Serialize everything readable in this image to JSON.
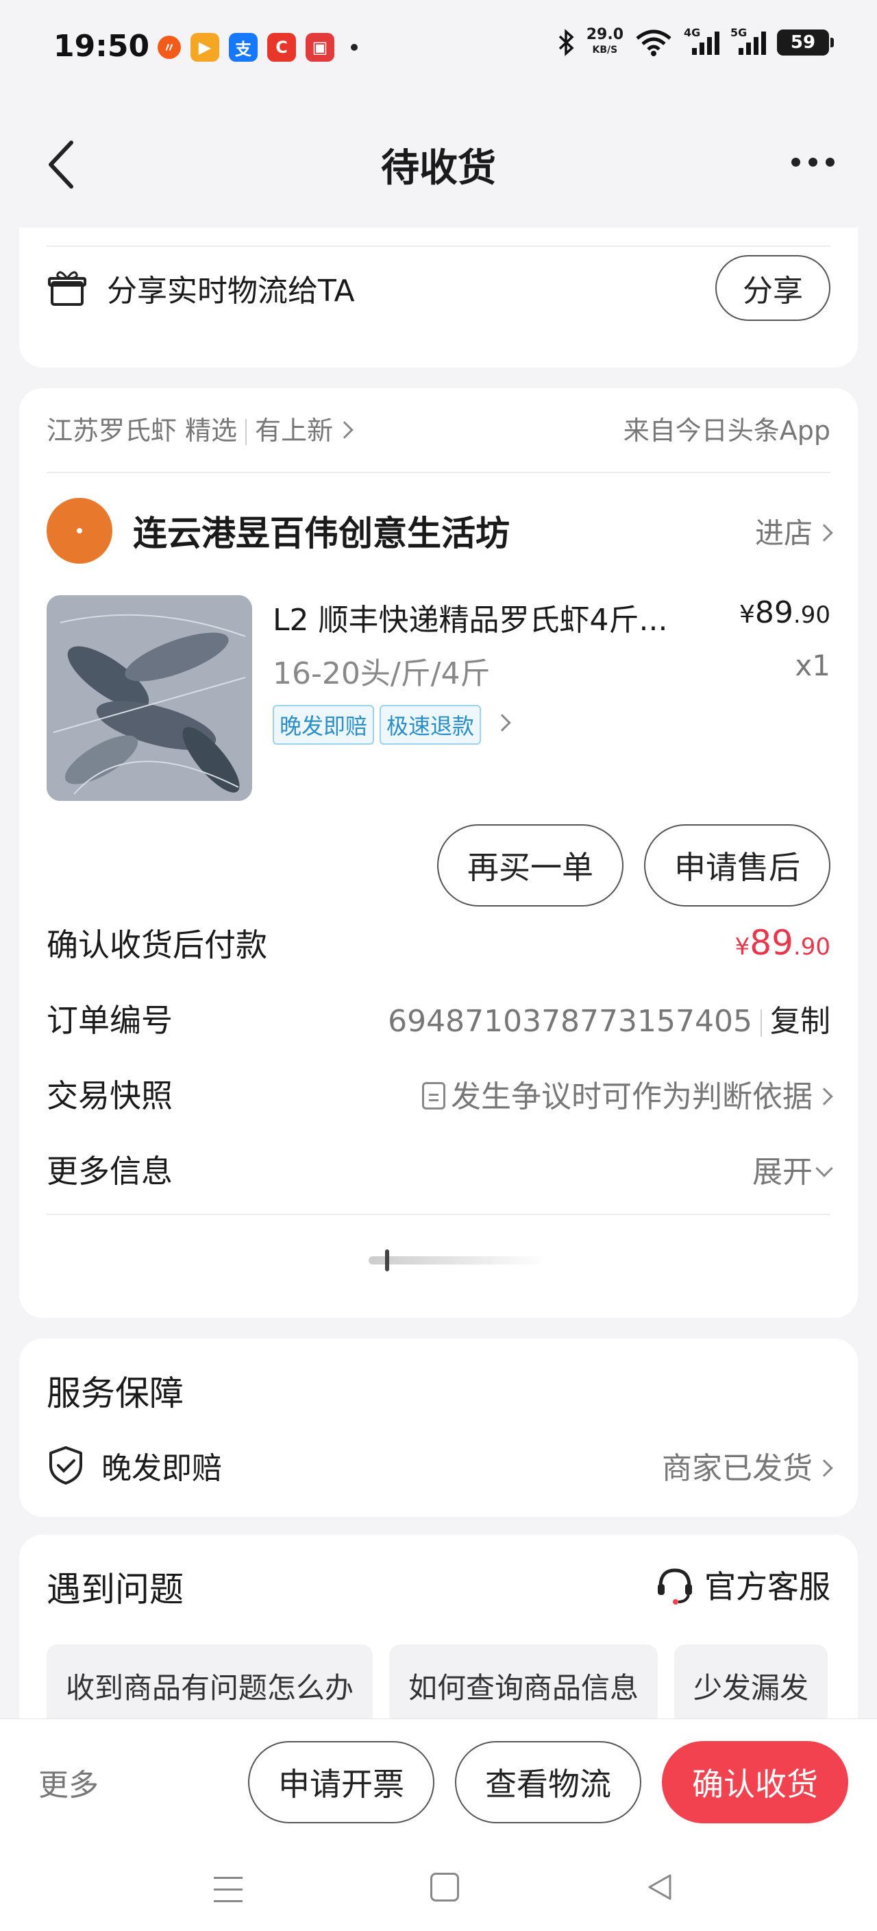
{
  "status_bar": {
    "time": "19:50",
    "net_speed": "29.0",
    "net_unit": "KB/S",
    "signal_4g": "4G",
    "signal_5g": "5G",
    "battery": "59",
    "apps": [
      {
        "icon": "weibo-app-icon",
        "color": "#f35b1a",
        "glyph": "〃"
      },
      {
        "icon": "video-app-icon",
        "color": "#f5a623",
        "glyph": "▶"
      },
      {
        "icon": "alipay-app-icon",
        "color": "#1677ff",
        "glyph": "支"
      },
      {
        "icon": "c-app-icon",
        "color": "#e8362a",
        "glyph": "C"
      },
      {
        "icon": "calendar-app-icon",
        "color": "#e23b3b",
        "glyph": "▣"
      }
    ]
  },
  "header": {
    "title": "待收货"
  },
  "share": {
    "text": "分享实时物流给TA",
    "button": "分享"
  },
  "order": {
    "shop_tag": "江苏罗氏虾 精选",
    "shop_new": "有上新",
    "source": "来自今日头条App",
    "store_name": "连云港昱百伟创意生活坊",
    "store_link": "进店",
    "product_title": "L2 顺丰快递精品罗氏虾4斤...",
    "price_yen": "¥",
    "price_int": "89",
    "price_dec": ".90",
    "spec": "16-20头/斤/4斤",
    "qty": "x1",
    "tags": [
      "晚发即赔",
      "极速退款"
    ],
    "buy_again": "再买一单",
    "after_sale": "申请售后",
    "pay_label": "确认收货后付款",
    "pay_yen": "¥",
    "pay_int": "89",
    "pay_dec": ".90",
    "order_no_label": "订单编号",
    "order_no": "6948710378773157405",
    "copy": "复制",
    "snapshot_label": "交易快照",
    "snapshot_value": "发生争议时可作为判断依据",
    "more_info_label": "更多信息",
    "more_info_value": "展开"
  },
  "service": {
    "title": "服务保障",
    "item": "晚发即赔",
    "status": "商家已发货"
  },
  "problems": {
    "title": "遇到问题",
    "cs": "官方客服",
    "faqs": [
      "收到商品有问题怎么办",
      "如何查询商品信息",
      "少发漏发"
    ]
  },
  "bottom": {
    "more": "更多",
    "invoice": "申请开票",
    "logistics": "查看物流",
    "confirm": "确认收货"
  },
  "colors": {
    "accent_red": "#f2414f",
    "price_red": "#e8364a",
    "tag_blue": "#2a8fc8",
    "store_avatar": "#e8792c"
  }
}
